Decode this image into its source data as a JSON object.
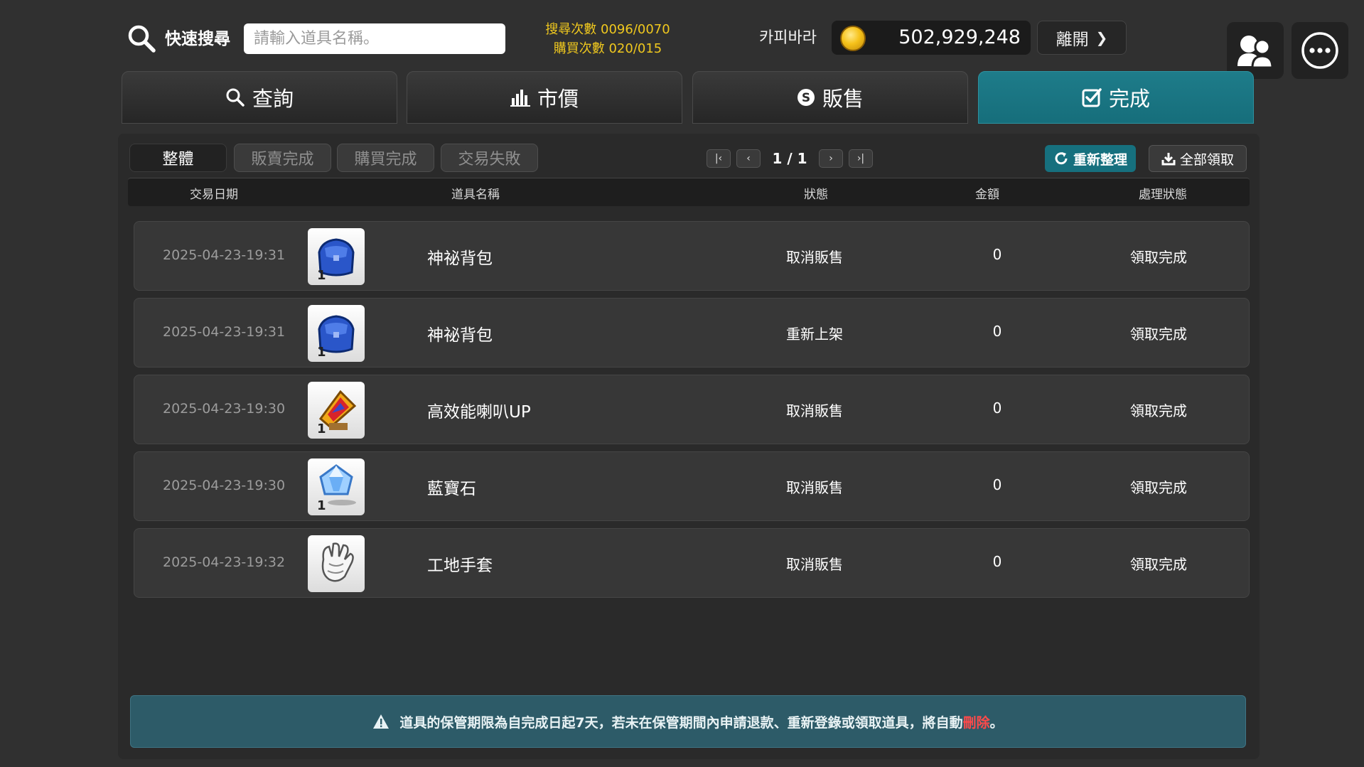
{
  "header": {
    "quick_search_label": "快速搜尋",
    "search_placeholder": "請輸入道具名稱。",
    "search_count": "搜尋次數 0096/0070",
    "buy_count": "購買次數 020/015",
    "username": "카피바라",
    "coin_amount": "502,929,248",
    "exit_label": "離開"
  },
  "tabs": [
    {
      "label": "查詢",
      "icon": "search-icon"
    },
    {
      "label": "市價",
      "icon": "bar-chart-icon"
    },
    {
      "label": "販售",
      "icon": "dollar-coin-icon"
    },
    {
      "label": "完成",
      "icon": "check-box-icon",
      "active": true
    }
  ],
  "filters": [
    {
      "label": "整體",
      "active": true
    },
    {
      "label": "販賣完成"
    },
    {
      "label": "購買完成"
    },
    {
      "label": "交易失敗"
    }
  ],
  "pagination": {
    "text": "1 / 1"
  },
  "actions": {
    "refresh_label": "重新整理",
    "claim_all_label": "全部領取"
  },
  "table": {
    "columns": [
      "交易日期",
      "道具名稱",
      "狀態",
      "金額",
      "處理狀態"
    ],
    "rows": [
      {
        "date": "2025-04-23-19:31",
        "icon": "blue-bag-icon",
        "name": "神祕背包",
        "status": "取消販售",
        "amount": "0",
        "process": "領取完成"
      },
      {
        "date": "2025-04-23-19:31",
        "icon": "blue-bag-icon",
        "name": "神祕背包",
        "status": "重新上架",
        "amount": "0",
        "process": "領取完成"
      },
      {
        "date": "2025-04-23-19:30",
        "icon": "megaphone-icon",
        "name": "高效能喇叭UP",
        "status": "取消販售",
        "amount": "0",
        "process": "領取完成"
      },
      {
        "date": "2025-04-23-19:30",
        "icon": "sapphire-icon",
        "name": "藍寶石",
        "status": "取消販售",
        "amount": "0",
        "process": "領取完成"
      },
      {
        "date": "2025-04-23-19:32",
        "icon": "work-glove-icon",
        "name": "工地手套",
        "status": "取消販售",
        "amount": "0",
        "process": "領取完成"
      }
    ]
  },
  "notice": {
    "text": "道具的保管期限為自完成日起7天，若未在保管期間內申請退款、重新登錄或領取道具，將自動",
    "highlight": "刪除",
    "end": "。"
  },
  "colors": {
    "accent": "#16707e",
    "coin": "#f6c21a",
    "count_text": "#f0c81e",
    "danger": "#ff4a4a"
  }
}
